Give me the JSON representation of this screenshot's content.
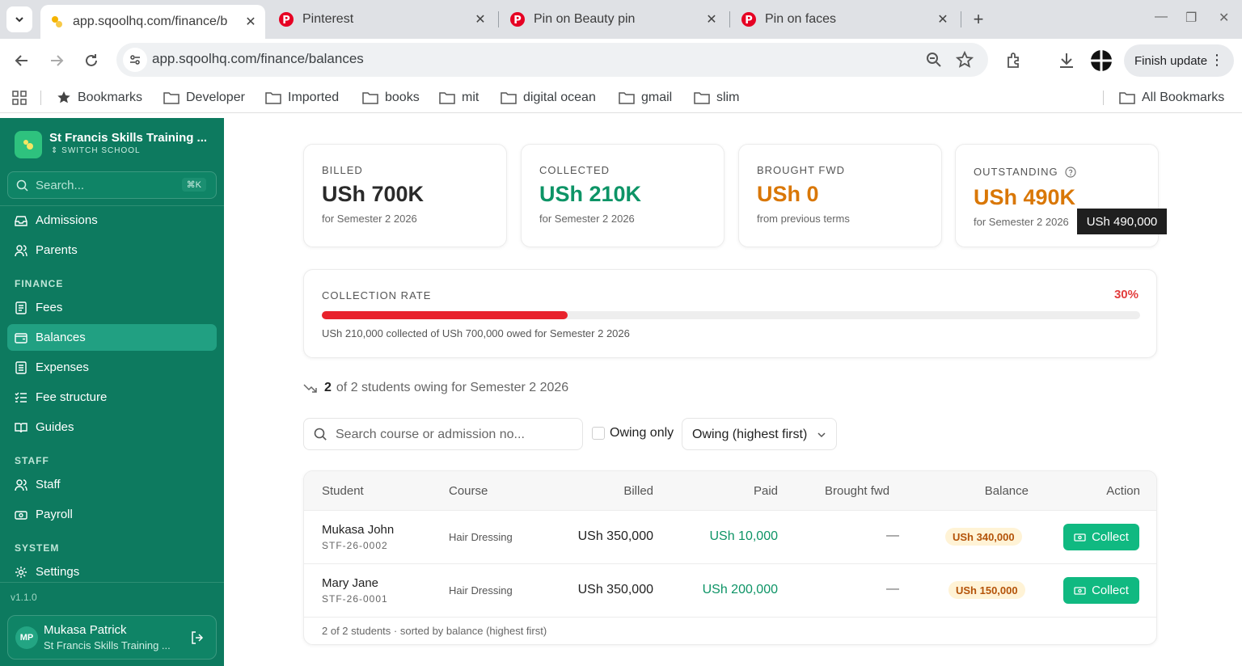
{
  "browser": {
    "tabs": [
      {
        "title": "app.sqoolhq.com/finance/b",
        "active": true
      },
      {
        "title": "Pinterest",
        "active": false
      },
      {
        "title": "Pin on Beauty pin",
        "active": false
      },
      {
        "title": "Pin on faces",
        "active": false
      }
    ],
    "url_host": "app.sqoolhq.com",
    "url_path": "/finance/balances",
    "finish_update": "Finish update",
    "bookmarks": [
      "Bookmarks",
      "Developer",
      "Imported",
      "books",
      "mit",
      "digital ocean",
      "gmail",
      "slim"
    ],
    "all_bookmarks": "All Bookmarks"
  },
  "sidebar": {
    "school_name": "St Francis Skills Training ...",
    "switch_label": "SWITCH SCHOOL",
    "search_placeholder": "Search...",
    "search_shortcut": "⌘K",
    "items_top": [
      {
        "label": "Admissions",
        "icon": "inbox-icon"
      },
      {
        "label": "Parents",
        "icon": "users-icon"
      }
    ],
    "finance_heading": "FINANCE",
    "finance_items": [
      {
        "label": "Fees",
        "icon": "receipt-icon",
        "active": false
      },
      {
        "label": "Balances",
        "icon": "wallet-icon",
        "active": true
      },
      {
        "label": "Expenses",
        "icon": "file-icon",
        "active": false
      },
      {
        "label": "Fee structure",
        "icon": "list-check-icon",
        "active": false
      },
      {
        "label": "Guides",
        "icon": "book-icon",
        "active": false
      }
    ],
    "staff_heading": "STAFF",
    "staff_items": [
      {
        "label": "Staff",
        "icon": "users-icon"
      },
      {
        "label": "Payroll",
        "icon": "banknote-icon"
      }
    ],
    "system_heading": "SYSTEM",
    "system_items": [
      {
        "label": "Settings",
        "icon": "gear-icon"
      }
    ],
    "version": "v1.1.0",
    "user": {
      "initials": "MP",
      "name": "Mukasa Patrick",
      "school": "St Francis Skills Training ..."
    }
  },
  "kpis": [
    {
      "label": "BILLED",
      "value": "USh 700K",
      "sub": "for Semester 2 2026",
      "color": "#2a2a2a"
    },
    {
      "label": "COLLECTED",
      "value": "USh 210K",
      "sub": "for Semester 2 2026",
      "color": "#0d9466"
    },
    {
      "label": "BROUGHT FWD",
      "value": "USh 0",
      "sub": "from previous terms",
      "color": "#d97706"
    },
    {
      "label": "OUTSTANDING",
      "value": "USh 490K",
      "sub": "for Semester 2 2026",
      "color": "#d97706"
    }
  ],
  "tooltip": "USh 490,000",
  "collection": {
    "label": "COLLECTION RATE",
    "percent_text": "30%",
    "rate": 0.3,
    "description": "USh 210,000 collected of USh 700,000 owed for Semester 2 2026"
  },
  "owing_summary": {
    "count": "2",
    "rest": "of 2 students owing for Semester 2 2026"
  },
  "filters": {
    "search_placeholder": "Search course or admission no...",
    "owing_only_label": "Owing only",
    "sort_value": "Owing (highest first)"
  },
  "table": {
    "headers": [
      "Student",
      "Course",
      "Billed",
      "Paid",
      "Brought fwd",
      "Balance",
      "Action"
    ],
    "rows": [
      {
        "name": "Mukasa John",
        "adm": "STF-26-0002",
        "course": "Hair Dressing",
        "billed": "USh 350,000",
        "paid": "USh 10,000",
        "bfwd": "—",
        "balance": "USh 340,000",
        "action": "Collect"
      },
      {
        "name": "Mary Jane",
        "adm": "STF-26-0001",
        "course": "Hair Dressing",
        "billed": "USh 350,000",
        "paid": "USh 200,000",
        "bfwd": "—",
        "balance": "USh 150,000",
        "action": "Collect"
      }
    ],
    "footer": "2 of 2 students · sorted by balance (highest first)"
  }
}
